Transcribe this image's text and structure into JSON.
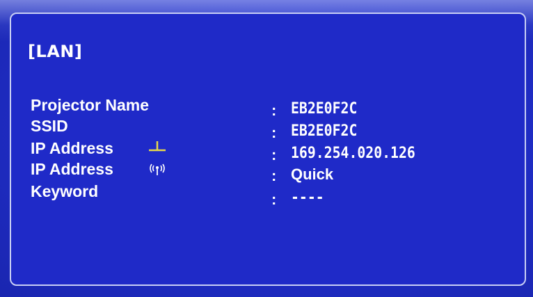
{
  "section": {
    "title": "[LAN]"
  },
  "rows": [
    {
      "label": "Projector Name",
      "colon": ":",
      "value": "EB2E0F2C"
    },
    {
      "label": "SSID",
      "colon": ":",
      "value": "EB2E0F2C"
    },
    {
      "label": "IP Address",
      "colon": ":",
      "value": "169.254.020.126",
      "icon": "wired-lan-icon"
    },
    {
      "label": "IP Address",
      "colon": ":",
      "value": "Quick",
      "icon": "wireless-lan-icon"
    },
    {
      "label": "Keyword",
      "colon": ":",
      "value": "----"
    }
  ],
  "colors": {
    "background": "#1f2ac8",
    "border": "#c9cff5",
    "text": "#ffffff",
    "wired_icon": "#e8d84a"
  }
}
